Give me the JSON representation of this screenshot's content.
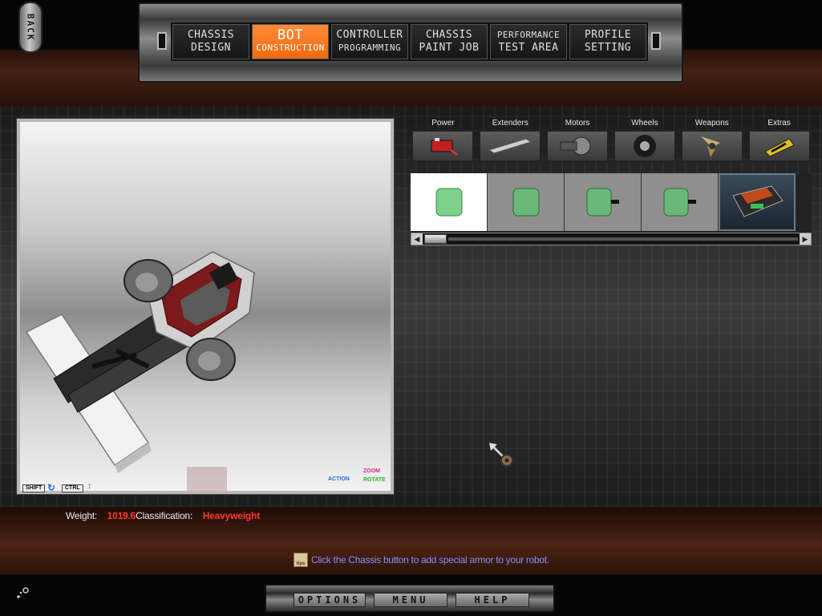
{
  "back_label": "BACK",
  "nav": {
    "tabs": [
      {
        "line1": "CHASSIS",
        "line2": "DESIGN",
        "active": false
      },
      {
        "line1": "BOT",
        "line2": "CONSTRUCTION",
        "active": true
      },
      {
        "line1": "CONTROLLER",
        "line2": "PROGRAMMING",
        "active": false
      },
      {
        "line1": "CHASSIS",
        "line2": "PAINT JOB",
        "active": false
      },
      {
        "line1": "PERFORMANCE",
        "line2": "TEST AREA",
        "active": false
      },
      {
        "line1": "PROFILE",
        "line2": "SETTING",
        "active": false
      }
    ]
  },
  "categories": [
    {
      "label": "Power",
      "icon": "battery-icon"
    },
    {
      "label": "Extenders",
      "icon": "extender-bar-icon"
    },
    {
      "label": "Motors",
      "icon": "motor-icon"
    },
    {
      "label": "Wheels",
      "icon": "wheel-icon"
    },
    {
      "label": "Weapons",
      "icon": "weapon-icon"
    },
    {
      "label": "Extras",
      "icon": "extras-icon"
    }
  ],
  "parts": [
    {
      "icon": "green-battery-icon",
      "selected": true
    },
    {
      "icon": "green-battery-icon",
      "selected": false
    },
    {
      "icon": "green-battery-connector-icon",
      "selected": false
    },
    {
      "icon": "green-battery-connector-icon",
      "selected": false
    },
    {
      "icon": "dark-battery-pack-icon",
      "selected": false
    }
  ],
  "viewport_hints": {
    "shift": "SHIFT",
    "ctrl": "CTRL",
    "action": "ACTION",
    "zoom": "ZOOM",
    "rotate": "ROTATE"
  },
  "status": {
    "weight_label": "Weight:",
    "weight_value": "1019.6",
    "class_label": "Classification:",
    "class_value": "Heavyweight"
  },
  "tip": {
    "icon_label": "tips",
    "text": "Click the Chassis button to add special armor to your robot."
  },
  "bottom": {
    "options": "OPTIONS",
    "menu": "MENU",
    "help": "HELP"
  },
  "colors": {
    "accent_orange": "#f06a10",
    "value_red": "#ff3a2a",
    "tip_blue": "#8a8aff"
  }
}
